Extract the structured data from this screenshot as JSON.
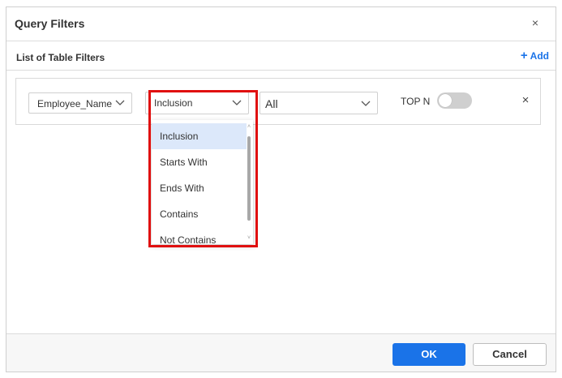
{
  "dialog": {
    "title": "Query Filters",
    "close_icon": "close-icon",
    "close_glyph": "×"
  },
  "section": {
    "title": "List of Table Filters",
    "add_label": "Add",
    "add_icon": "plus-icon",
    "add_glyph": "+"
  },
  "filter_row": {
    "field_value": "Employee_Name",
    "operator_value": "Inclusion",
    "value_value": "All",
    "topn_label": "TOP N",
    "topn_enabled": false,
    "remove_glyph": "×"
  },
  "operator_dropdown": {
    "items": [
      {
        "label": "Inclusion",
        "selected": true
      },
      {
        "label": "Starts With",
        "selected": false
      },
      {
        "label": "Ends With",
        "selected": false
      },
      {
        "label": "Contains",
        "selected": false
      },
      {
        "label": "Not Contains",
        "selected": false
      }
    ],
    "scroll_up_glyph": "˄",
    "scroll_down_glyph": "˅"
  },
  "footer": {
    "ok_label": "OK",
    "cancel_label": "Cancel"
  },
  "colors": {
    "accent": "#1a73e8",
    "highlight": "#e01010",
    "selected_item_bg": "#dce8fa"
  }
}
